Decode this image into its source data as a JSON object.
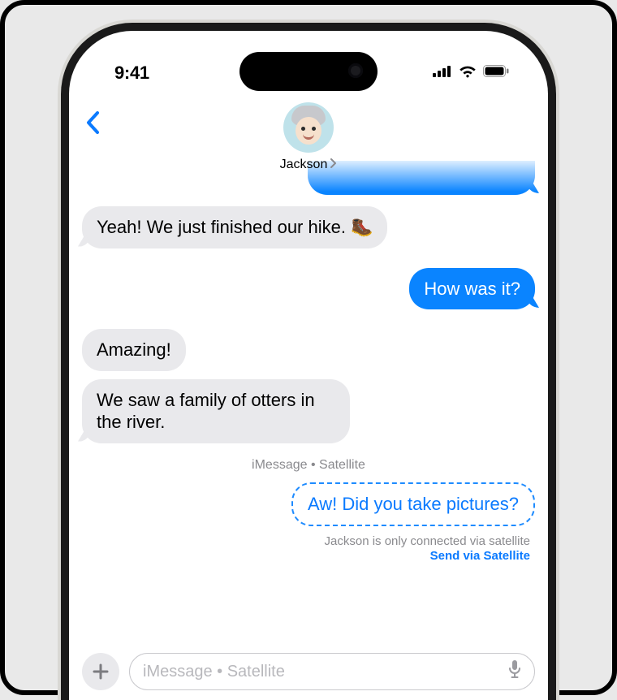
{
  "status": {
    "time": "9:41"
  },
  "contact": {
    "name": "Jackson"
  },
  "messages": {
    "m0_recv": "Yeah! We just finished our hike. 🥾",
    "m1_sent": "How was it?",
    "m2_recv": "Amazing!",
    "m3_recv": "We saw a family of otters in the river.",
    "divider": "iMessage • Satellite",
    "m4_pending": "Aw! Did you take pictures?"
  },
  "satellite": {
    "note": "Jackson is only connected via satellite",
    "link": "Send via Satellite"
  },
  "compose": {
    "placeholder": "iMessage • Satellite"
  }
}
